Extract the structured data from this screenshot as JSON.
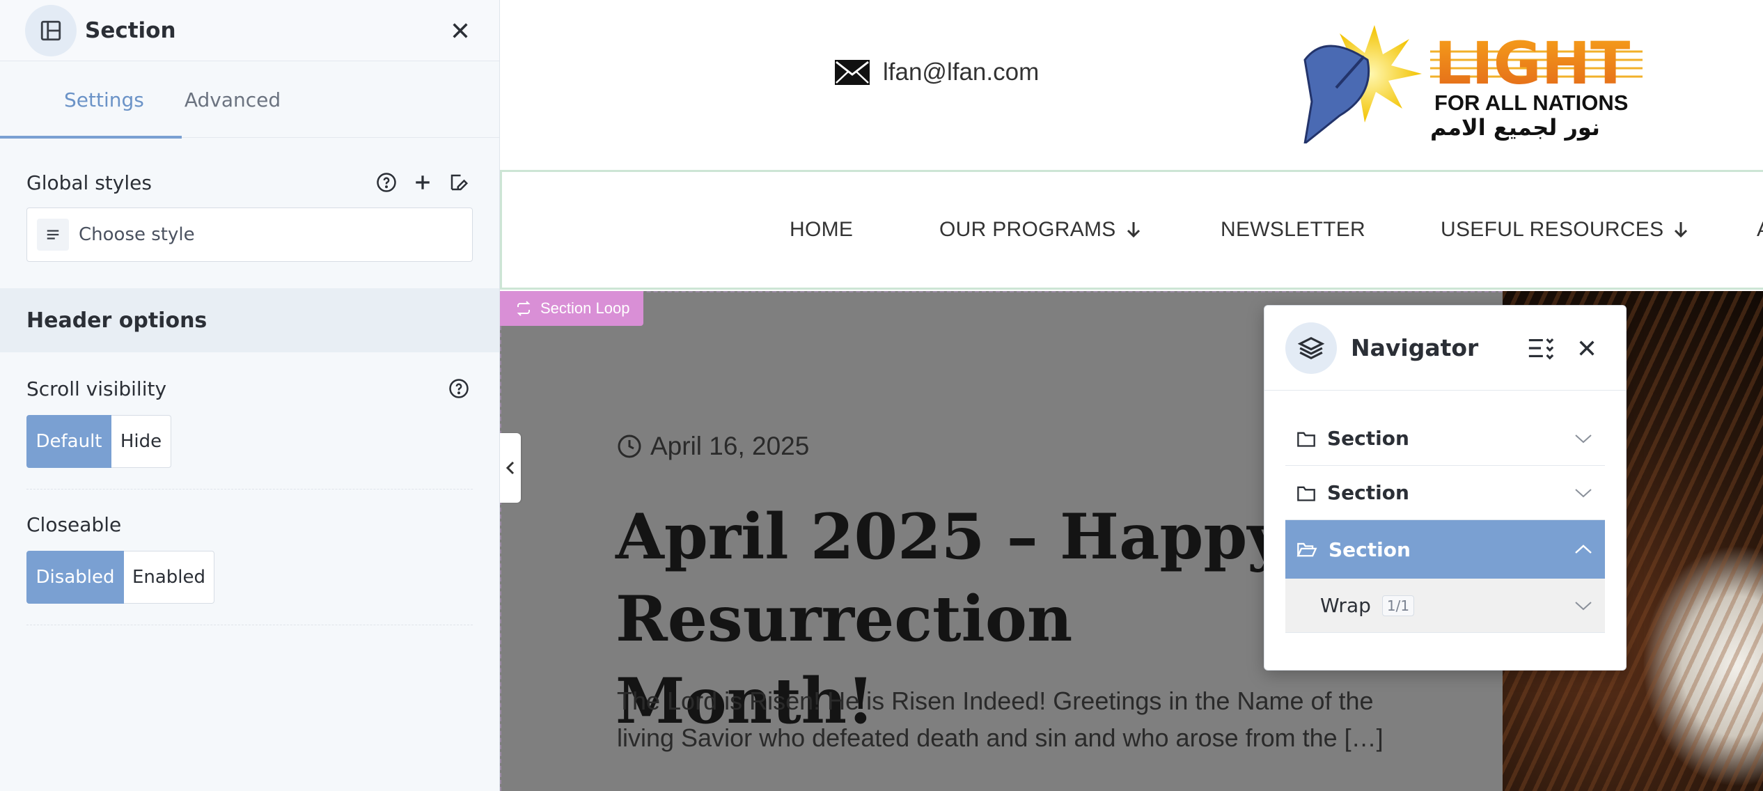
{
  "panel": {
    "title": "Section",
    "tabs": [
      {
        "label": "Settings"
      },
      {
        "label": "Advanced"
      }
    ],
    "global_styles": {
      "label": "Global styles",
      "placeholder": "Choose style"
    },
    "header_options": "Header options",
    "scroll_visibility": {
      "label": "Scroll visibility",
      "options": [
        "Default",
        "Hide"
      ],
      "selected": "Default"
    },
    "closeable": {
      "label": "Closeable",
      "options": [
        "Disabled",
        "Enabled"
      ],
      "selected": "Disabled"
    }
  },
  "site": {
    "email": "lfan@lfan.com",
    "logo": {
      "line1": "LIGHT",
      "line2": "FOR ALL NATIONS",
      "line3": "نور لجميع الامم"
    },
    "nav": [
      "HOME",
      "OUR PROGRAMS",
      "NEWSLETTER",
      "USEFUL RESOURCES",
      "A"
    ],
    "section_loop_label": "Section Loop",
    "post": {
      "date": "April 16, 2025",
      "title": "April 2025 – Happy Resurrection Month!",
      "excerpt": "The Lord is Risen! He is Risen Indeed! Greetings in the Name of the living Savior who defeated death and sin and who arose from the […]"
    }
  },
  "navigator": {
    "title": "Navigator",
    "items": [
      {
        "label": "Section",
        "expanded": false,
        "selected": false
      },
      {
        "label": "Section",
        "expanded": false,
        "selected": false
      },
      {
        "label": "Section",
        "expanded": true,
        "selected": true
      }
    ],
    "child": {
      "label": "Wrap",
      "badge": "1/1"
    }
  },
  "colors": {
    "accent": "#7aa0d2",
    "section_loop": "#d98fd6",
    "hero_overlay": "#7f7f7f"
  }
}
